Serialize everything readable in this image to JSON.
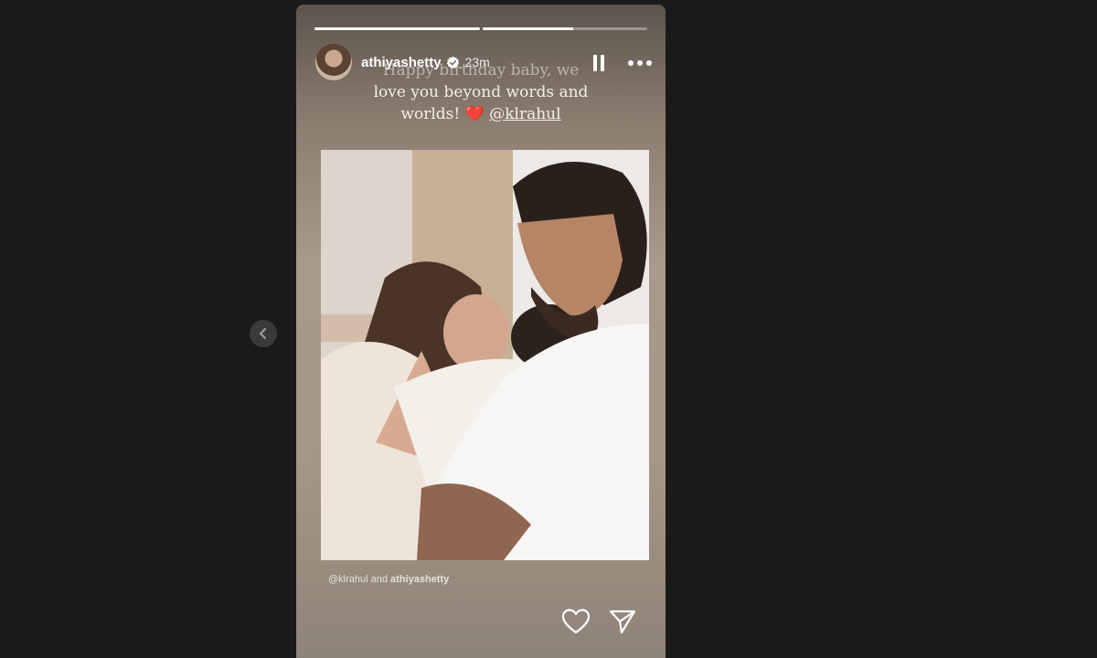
{
  "story": {
    "username": "athiyashetty",
    "time": "23m",
    "progress": [
      1.0,
      0.55
    ],
    "caption": {
      "line1": "Happy birthday baby, we",
      "line2": "love you beyond words and",
      "line3": "worlds! ",
      "emoji": "❤️",
      "mention": "@klrahul"
    },
    "tags": {
      "first": "@klrahul",
      "and": " and ",
      "second": "athiyashetty"
    }
  },
  "icons": {
    "verified": "verified-badge-icon",
    "pause": "pause-icon",
    "more": "more-options-icon",
    "like": "heart-icon",
    "share": "send-icon",
    "previous": "chevron-left-icon"
  },
  "colors": {
    "background": "#1a1a1a",
    "verified": "#ffffff",
    "emoji_heart": "#e0201b"
  }
}
